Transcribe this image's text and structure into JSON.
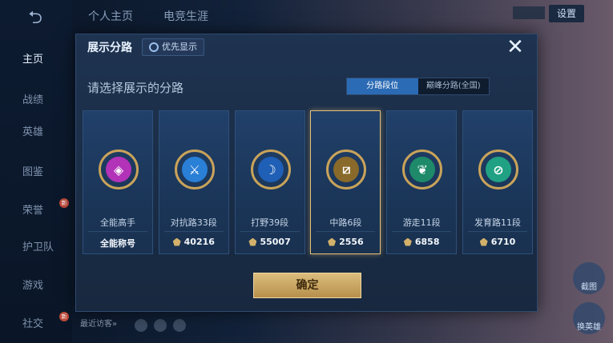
{
  "topbar": {
    "tab1": "个人主页",
    "tab2": "电竞生涯",
    "settings": "设置"
  },
  "sidebar": {
    "items": [
      {
        "label": "主页",
        "active": true
      },
      {
        "label": "战绩"
      },
      {
        "label": "英雄"
      },
      {
        "label": "图鉴"
      },
      {
        "label": "荣誉",
        "badge": "新"
      },
      {
        "label": "护卫队"
      },
      {
        "label": "游戏"
      },
      {
        "label": "社交",
        "badge": "新"
      }
    ]
  },
  "bottom": {
    "visitors": "最近访客»"
  },
  "right_buttons": [
    {
      "label": "截图"
    },
    {
      "label": "换英雄"
    }
  ],
  "modal": {
    "title": "展示分路",
    "priority_label": "优先显示",
    "subtitle": "请选择展示的分路",
    "tabs": [
      {
        "label": "分路段位",
        "active": true
      },
      {
        "label": "巅峰分路(全国)",
        "active": false
      }
    ],
    "cards": [
      {
        "label": "全能高手",
        "value": "全能称号",
        "icon": "allround-emblem-icon",
        "color": "#b232b8",
        "glyph": "◈",
        "show_value_icon": false
      },
      {
        "label": "对抗路33段",
        "value": "40216",
        "icon": "clash-lane-emblem-icon",
        "color": "#2a7fd6",
        "glyph": "⚔",
        "show_value_icon": true
      },
      {
        "label": "打野39段",
        "value": "55007",
        "icon": "jungle-emblem-icon",
        "color": "#1f5fb5",
        "glyph": "☽",
        "show_value_icon": true
      },
      {
        "label": "中路6段",
        "value": "2556",
        "icon": "mid-lane-emblem-icon",
        "color": "#8a6a2a",
        "glyph": "⧄",
        "show_value_icon": true,
        "selected": true
      },
      {
        "label": "游走11段",
        "value": "6858",
        "icon": "roam-emblem-icon",
        "color": "#1e8a6a",
        "glyph": "❦",
        "show_value_icon": true
      },
      {
        "label": "发育路11段",
        "value": "6710",
        "icon": "farm-lane-emblem-icon",
        "color": "#21a184",
        "glyph": "⊘",
        "show_value_icon": true
      }
    ],
    "confirm_label": "确定"
  }
}
